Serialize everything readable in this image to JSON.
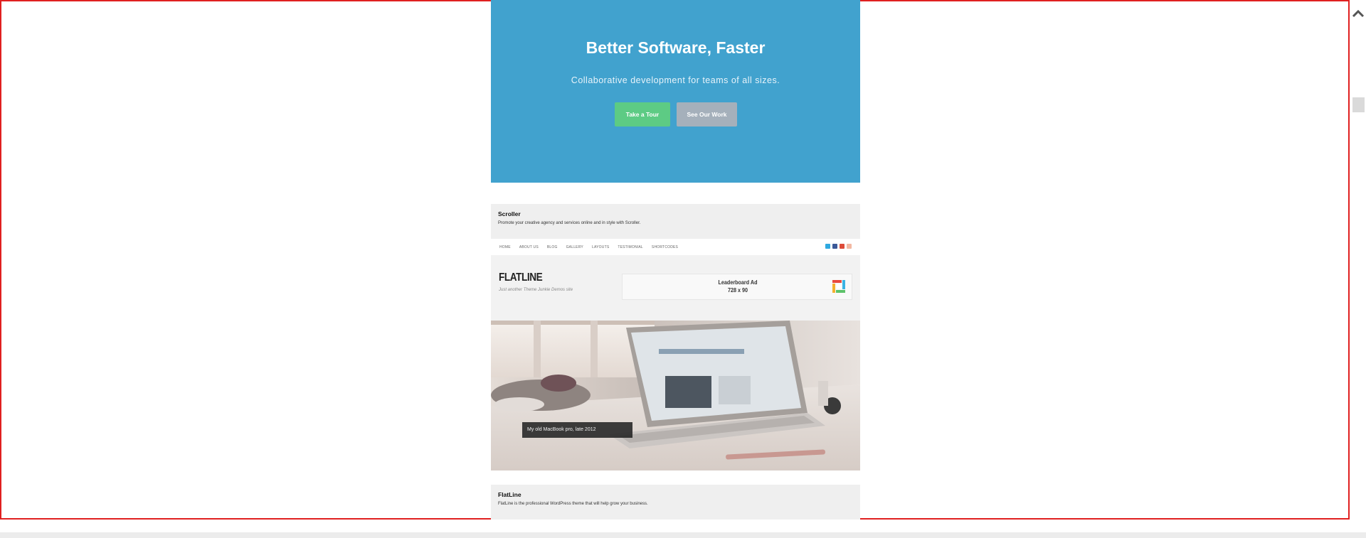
{
  "hero": {
    "title": "Better Software, Faster",
    "subtitle": "Collaborative development for teams of all sizes.",
    "primary_button": "Take a Tour",
    "secondary_button": "See Our Work",
    "background": "#41a2ce"
  },
  "card1": {
    "title": "Scroller",
    "description": "Promote your creative agency and services online and in style with Scroller."
  },
  "theme_preview": {
    "nav_items": [
      "HOME",
      "ABOUT US",
      "BLOG",
      "GALLERY",
      "LAYOUTS",
      "TESTIMONIAL",
      "SHORTCODES"
    ],
    "social_icons": [
      "twitter-icon",
      "facebook-icon",
      "google-plus-icon",
      "rss-icon"
    ],
    "logo": "FLATLINE",
    "tagline": "Just another Theme Junkie Demos site",
    "ad_line1": "Leaderboard Ad",
    "ad_line2": "728 x 90",
    "photo_caption": "My old MacBook pro, late 2012"
  },
  "card2": {
    "title": "FlatLine",
    "description": "FlatLine is the professional WordPress theme that will help grow your business."
  },
  "colors": {
    "frame_border": "#e02020",
    "button_green": "#5dcb84",
    "button_gray": "#a5b0bb"
  }
}
